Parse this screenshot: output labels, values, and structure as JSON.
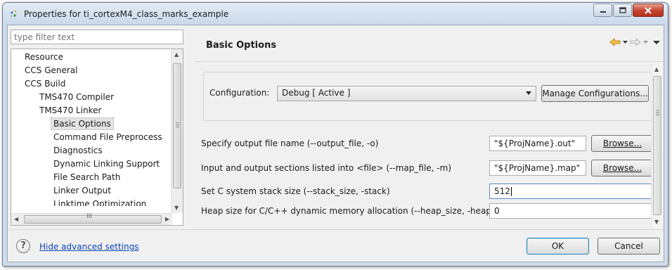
{
  "window": {
    "title": "Properties for ti_cortexM4_class_marks_example"
  },
  "sidebar": {
    "filter_placeholder": "type filter text",
    "items": [
      {
        "label": "Resource",
        "level": 1
      },
      {
        "label": "CCS General",
        "level": 1
      },
      {
        "label": "CCS Build",
        "level": 1
      },
      {
        "label": "TMS470 Compiler",
        "level": 2
      },
      {
        "label": "TMS470 Linker",
        "level": 2
      },
      {
        "label": "Basic Options",
        "level": 3,
        "selected": true
      },
      {
        "label": "Command File Preprocess",
        "level": 3
      },
      {
        "label": "Diagnostics",
        "level": 3
      },
      {
        "label": "Dynamic Linking Support",
        "level": 3
      },
      {
        "label": "File Search Path",
        "level": 3
      },
      {
        "label": "Linker Output",
        "level": 3
      },
      {
        "label": "Linktime Optimization",
        "level": 3
      }
    ],
    "hscroll_grip": "III"
  },
  "page": {
    "title": "Basic Options",
    "configuration_label": "Configuration:",
    "configuration_value": "Debug  [ Active ]",
    "manage_button": "Manage Configurations...",
    "options": [
      {
        "label": "Specify output file name (--output_file, -o)",
        "value": "\"${ProjName}.out\"",
        "button": "Browse..."
      },
      {
        "label": "Input and output sections listed into <file> (--map_file, -m)",
        "value": "\"${ProjName}.map\"",
        "button": "Browse..."
      },
      {
        "label": "Set C system stack size (--stack_size, -stack)",
        "value": "512"
      },
      {
        "label": "Heap size for C/C++ dynamic memory allocation (--heap_size, -heap)",
        "value": "0"
      }
    ]
  },
  "footer": {
    "help_glyph": "?",
    "advanced_link": "Hide advanced settings",
    "ok_button": "OK",
    "cancel_button": "Cancel"
  },
  "colors": {
    "link": "#0b42b8",
    "nav_arrow_back": "#e8a21a",
    "close_button": "#c9452f"
  },
  "icons": [
    "window-icon",
    "minimize-icon",
    "maximize-icon",
    "close-icon",
    "back-arrow-icon",
    "forward-arrow-icon",
    "menu-dropdown-icon",
    "help-icon"
  ]
}
